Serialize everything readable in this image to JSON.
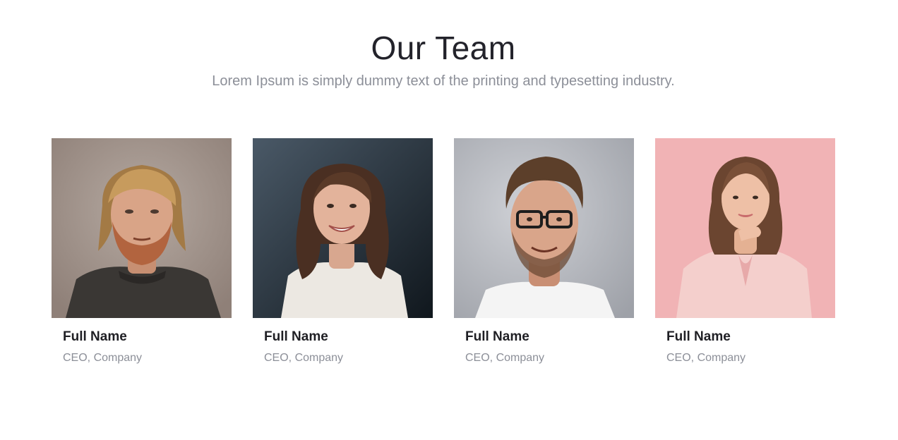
{
  "section": {
    "title": "Our Team",
    "subtitle": "Lorem Ipsum is simply dummy text of the printing and typesetting industry."
  },
  "members": [
    {
      "name": "Full Name",
      "role": "CEO, Company",
      "photo": {
        "icon": "portrait-man-blond",
        "background": "#a69a93",
        "skin": "#d9a487",
        "hair": "#b68a4f",
        "clothing": "#3a3734"
      }
    },
    {
      "name": "Full Name",
      "role": "CEO, Company",
      "photo": {
        "icon": "portrait-woman-brunette",
        "background": "#3d4b57",
        "skin": "#e3b39b",
        "hair": "#4a2f22",
        "clothing": "#ece8e2"
      }
    },
    {
      "name": "Full Name",
      "role": "CEO, Company",
      "photo": {
        "icon": "portrait-man-glasses",
        "background": "#b9bcc3",
        "skin": "#d9a58a",
        "hair": "#5c3f2a",
        "clothing": "#f4f4f4"
      }
    },
    {
      "name": "Full Name",
      "role": "CEO, Company",
      "photo": {
        "icon": "portrait-woman-pink",
        "background": "#f1b3b5",
        "skin": "#eec0a6",
        "hair": "#6b4530",
        "clothing": "#f4cfcc"
      }
    }
  ]
}
